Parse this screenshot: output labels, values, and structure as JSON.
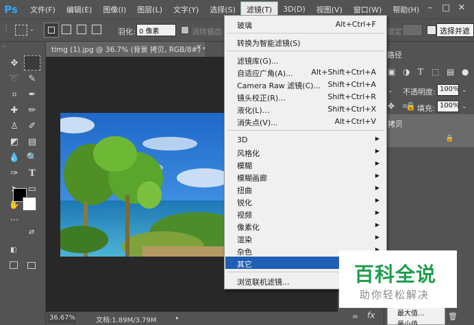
{
  "app": {
    "logo": "Ps"
  },
  "menubar": {
    "items": [
      "文件(F)",
      "编辑(E)",
      "图像(I)",
      "图层(L)",
      "文字(Y)",
      "选择(S)",
      "滤镜(T)",
      "3D(D)",
      "视图(V)",
      "窗口(W)",
      "帮助(H)"
    ],
    "active": "滤镜(T)"
  },
  "options": {
    "feather_label": "羽化:",
    "feather_value": "0 像素",
    "antialias_label": "消除锯齿",
    "edge_label": "锁定",
    "select_subject": "选择并遮"
  },
  "document": {
    "tab_title": "timg (1).jpg @ 36.7% (背景 拷贝, RGB/8#) *",
    "zoom": "36.67%",
    "doc_info": "文档:1.89M/3.79M"
  },
  "right_panel": {
    "tab": "路径",
    "opacity_label": "不透明度:",
    "opacity_value": "100%",
    "fill_label": "填充:",
    "fill_value": "100%",
    "layer_name": "拷贝"
  },
  "filter_menu": {
    "items": [
      {
        "label": "玻璃",
        "shortcut": "Alt+Ctrl+F"
      },
      {
        "label": "转换为智能滤镜(S)",
        "shortcut": ""
      },
      {
        "label": "滤镜库(G)...",
        "shortcut": ""
      },
      {
        "label": "自适应广角(A)...",
        "shortcut": "Alt+Shift+Ctrl+A"
      },
      {
        "label": "Camera Raw 滤镜(C)...",
        "shortcut": "Shift+Ctrl+A"
      },
      {
        "label": "镜头校正(R)...",
        "shortcut": "Shift+Ctrl+R"
      },
      {
        "label": "液化(L)...",
        "shortcut": "Shift+Ctrl+X"
      },
      {
        "label": "消失点(V)...",
        "shortcut": "Alt+Ctrl+V"
      },
      {
        "label": "3D",
        "submenu": true
      },
      {
        "label": "风格化",
        "submenu": true
      },
      {
        "label": "模糊",
        "submenu": true
      },
      {
        "label": "模糊画廊",
        "submenu": true
      },
      {
        "label": "扭曲",
        "submenu": true
      },
      {
        "label": "锐化",
        "submenu": true
      },
      {
        "label": "视频",
        "submenu": true
      },
      {
        "label": "像素化",
        "submenu": true
      },
      {
        "label": "渲染",
        "submenu": true
      },
      {
        "label": "杂色",
        "submenu": true
      },
      {
        "label": "其它",
        "submenu": true
      },
      {
        "label": "浏览联机滤镜...",
        "shortcut": ""
      }
    ],
    "highlighted": "其它"
  },
  "other_submenu": {
    "items": [
      "最大值...",
      "最小值..."
    ]
  },
  "watermark": {
    "title": "百科全说",
    "subtitle": "助你轻松解决"
  },
  "colors": {
    "ui_bg": "#535353",
    "canvas_bg": "#282828",
    "menu_bg": "#f0f0f0",
    "highlight": "#1e5eb4",
    "ps_blue": "#31a8ff",
    "watermark_green": "#1f9e4e"
  },
  "icons": {
    "tools": [
      "move-icon",
      "marquee-icon",
      "lasso-icon",
      "quick-select-icon",
      "crop-icon",
      "eyedropper-icon",
      "healing-icon",
      "brush-icon",
      "stamp-icon",
      "history-brush-icon",
      "eraser-icon",
      "gradient-icon",
      "blur-icon",
      "dodge-icon",
      "pen-icon",
      "type-icon",
      "path-select-icon",
      "shape-icon",
      "hand-icon",
      "zoom-icon",
      "more-icon"
    ]
  }
}
